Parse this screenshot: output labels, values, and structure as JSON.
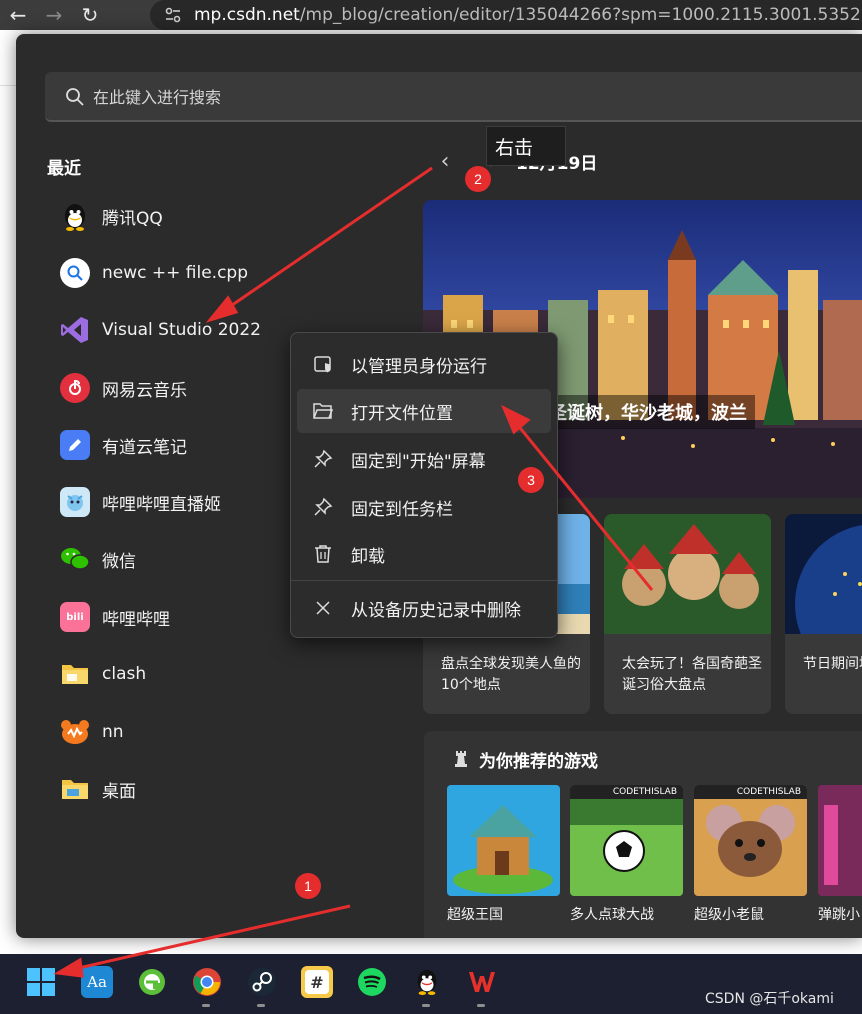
{
  "browser": {
    "url_host": "mp.csdn.net",
    "url_path": "/mp_blog/creation/editor/135044266?spm=1000.2115.3001.5352"
  },
  "search": {
    "placeholder": "在此键入进行搜索"
  },
  "recent": {
    "title": "最近",
    "items": [
      {
        "label": "腾讯QQ",
        "icon": "qq-icon"
      },
      {
        "label": "newc ++ file.cpp",
        "icon": "file-search-icon"
      },
      {
        "label": "Visual Studio 2022",
        "icon": "visual-studio-icon"
      },
      {
        "label": "网易云音乐",
        "icon": "netease-music-icon"
      },
      {
        "label": "有道云笔记",
        "icon": "youdao-note-icon"
      },
      {
        "label": "哔哩哔哩直播姬",
        "icon": "bilibili-live-icon"
      },
      {
        "label": "微信",
        "icon": "wechat-icon"
      },
      {
        "label": "哔哩哔哩",
        "icon": "bilibili-icon"
      },
      {
        "label": "clash",
        "icon": "folder-icon"
      },
      {
        "label": "nn",
        "icon": "nn-icon"
      },
      {
        "label": "桌面",
        "icon": "folder-icon"
      }
    ]
  },
  "news": {
    "date": "12月19日",
    "tooltip": "右击",
    "hero_caption": "的圣诞树，华沙老城，波兰",
    "cards": [
      {
        "text": "盘点全球发现美人鱼的10个地点"
      },
      {
        "text": "太会玩了！各国奇葩圣诞习俗大盘点"
      },
      {
        "text": "节日期间地如何被"
      }
    ]
  },
  "games": {
    "title": "为你推荐的游戏",
    "items": [
      {
        "name": "超级王国",
        "badge": ""
      },
      {
        "name": "多人点球大战",
        "badge": "CODETHISLAB"
      },
      {
        "name": "超级小老鼠",
        "badge": "CODETHISLAB"
      },
      {
        "name": "弹跳小",
        "badge": ""
      }
    ]
  },
  "context_menu": {
    "items": [
      {
        "label": "以管理员身份运行",
        "icon": "shield-run-icon"
      },
      {
        "label": "打开文件位置",
        "icon": "folder-open-icon"
      },
      {
        "label": "固定到\"开始\"屏幕",
        "icon": "pin-icon"
      },
      {
        "label": "固定到任务栏",
        "icon": "pin-icon"
      },
      {
        "label": "卸载",
        "icon": "trash-icon"
      },
      {
        "label": "从设备历史记录中删除",
        "icon": "close-icon"
      }
    ]
  },
  "taskbar": {
    "apps": [
      "windows-start-icon",
      "dictionary-icon",
      "browser-e-icon",
      "chrome-icon",
      "steam-icon",
      "hash-app-icon",
      "spotify-icon",
      "qq-icon",
      "wps-icon"
    ],
    "watermark": "CSDN @石千okami"
  },
  "annotations": {
    "badge1": "1",
    "badge2": "2",
    "badge3": "3"
  },
  "colors": {
    "accent_red": "#e52d2d",
    "menu_bg": "#2b2b2b",
    "taskbar_bg": "#1c2030"
  }
}
